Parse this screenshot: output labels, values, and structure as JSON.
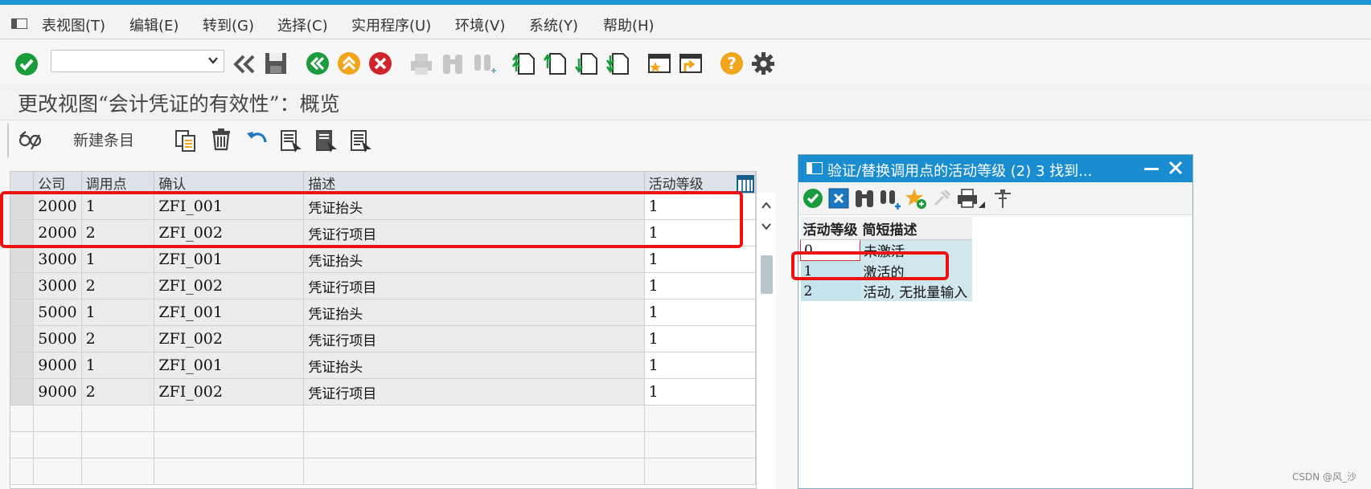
{
  "menu": {
    "items": [
      {
        "label": "表视图(T)"
      },
      {
        "label": "编辑(E)"
      },
      {
        "label": "转到(G)"
      },
      {
        "label": "选择(C)"
      },
      {
        "label": "实用程序(U)"
      },
      {
        "label": "环境(V)"
      },
      {
        "label": "系统(Y)"
      },
      {
        "label": "帮助(H)"
      }
    ]
  },
  "command_field": {
    "value": ""
  },
  "page": {
    "title": "更改视图“会计凭证的有效性”：概览"
  },
  "app_toolbar": {
    "new_entries_label": "新建条目"
  },
  "grid": {
    "columns": [
      "公司",
      "调用点",
      "确认",
      "描述",
      "活动等级"
    ],
    "rows": [
      [
        "2000",
        "1",
        "ZFI_001",
        "凭证抬头",
        "1"
      ],
      [
        "2000",
        "2",
        "ZFI_002",
        "凭证行项目",
        "1"
      ],
      [
        "3000",
        "1",
        "ZFI_001",
        "凭证抬头",
        "1"
      ],
      [
        "3000",
        "2",
        "ZFI_002",
        "凭证行项目",
        "1"
      ],
      [
        "5000",
        "1",
        "ZFI_001",
        "凭证抬头",
        "1"
      ],
      [
        "5000",
        "2",
        "ZFI_002",
        "凭证行项目",
        "1"
      ],
      [
        "9000",
        "1",
        "ZFI_001",
        "凭证抬头",
        "1"
      ],
      [
        "9000",
        "2",
        "ZFI_002",
        "凭证行项目",
        "1"
      ]
    ]
  },
  "popup": {
    "title": "验证/替换调用点的活动等级 (2)    3 找到...",
    "columns": [
      "活动等级",
      "简短描述"
    ],
    "rows": [
      [
        "0",
        "未激活"
      ],
      [
        "1",
        "激活的"
      ],
      [
        "2",
        "活动, 无批量输入"
      ]
    ]
  },
  "watermark": "CSDN @风_沙",
  "colors": {
    "sap_blue": "#1c95d3",
    "highlight_red": "#e11111",
    "ok_green": "#1a9b3c"
  }
}
